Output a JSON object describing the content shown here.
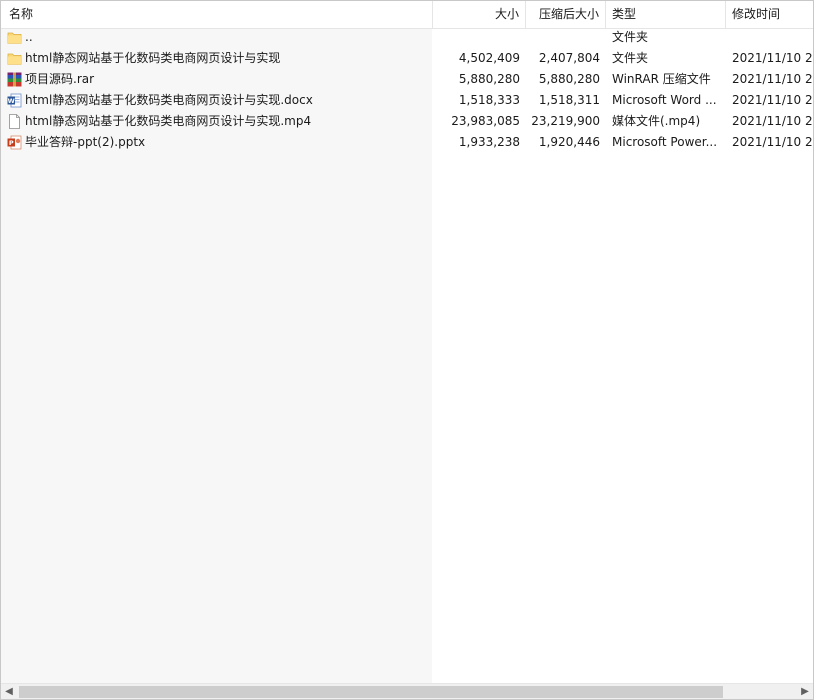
{
  "columns": {
    "name": "名称",
    "size": "大小",
    "packed": "压缩后大小",
    "type": "类型",
    "modified": "修改时间"
  },
  "sort_indicator": "^",
  "files": [
    {
      "name": "..",
      "icon": "folder-icon",
      "size": "",
      "packed": "",
      "type": "文件夹",
      "modified": ""
    },
    {
      "name": "html静态网站基于化数码类电商网页设计与实现",
      "icon": "folder-icon",
      "size": "4,502,409",
      "packed": "2,407,804",
      "type": "文件夹",
      "modified": "2021/11/10 2."
    },
    {
      "name": "项目源码.rar",
      "icon": "winrar-icon",
      "size": "5,880,280",
      "packed": "5,880,280",
      "type": "WinRAR 压缩文件",
      "modified": "2021/11/10 2."
    },
    {
      "name": "html静态网站基于化数码类电商网页设计与实现.docx",
      "icon": "word-document-icon",
      "size": "1,518,333",
      "packed": "1,518,311",
      "type": "Microsoft Word ...",
      "modified": "2021/11/10 2."
    },
    {
      "name": "html静态网站基于化数码类电商网页设计与实现.mp4",
      "icon": "blank-file-icon",
      "size": "23,983,085",
      "packed": "23,219,900",
      "type": "媒体文件(.mp4)",
      "modified": "2021/11/10 2."
    },
    {
      "name": "毕业答辩-ppt(2).pptx",
      "icon": "powerpoint-icon",
      "size": "1,933,238",
      "packed": "1,920,446",
      "type": "Microsoft Power...",
      "modified": "2021/11/10 2."
    }
  ],
  "scrollbar": {
    "left_arrow": "◀",
    "right_arrow": "▶"
  }
}
